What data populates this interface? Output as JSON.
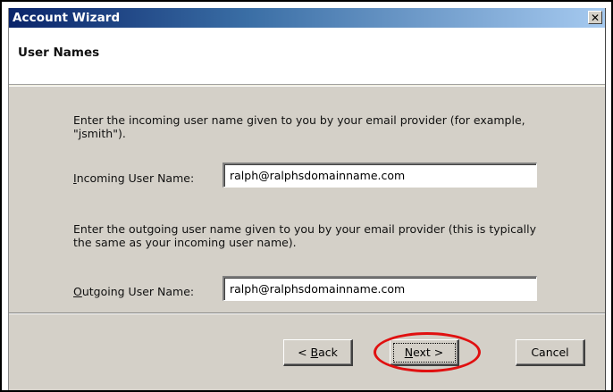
{
  "window": {
    "title": "Account Wizard",
    "close_icon": "close-icon",
    "close_glyph": "✕"
  },
  "header": {
    "title": "User Names"
  },
  "body": {
    "incoming_instructions": "Enter the incoming user name given to you by your email provider (for example, \"jsmith\").",
    "incoming_label_access": "I",
    "incoming_label_rest": "ncoming User Name:",
    "incoming_value": "ralph@ralphsdomainname.com",
    "outgoing_instructions": "Enter the outgoing user name given to you by your email provider (this is typically the same as your incoming user name).",
    "outgoing_label_access": "O",
    "outgoing_label_rest": "utgoing User Name:",
    "outgoing_value": "ralph@ralphsdomainname.com"
  },
  "footer": {
    "back_prefix": "< ",
    "back_access": "B",
    "back_rest": "ack",
    "next_access": "N",
    "next_rest": "ext >",
    "cancel_label": "Cancel"
  },
  "colors": {
    "highlight": "#e01010",
    "titlebar_start": "#0a246a",
    "titlebar_end": "#a6caf0"
  }
}
